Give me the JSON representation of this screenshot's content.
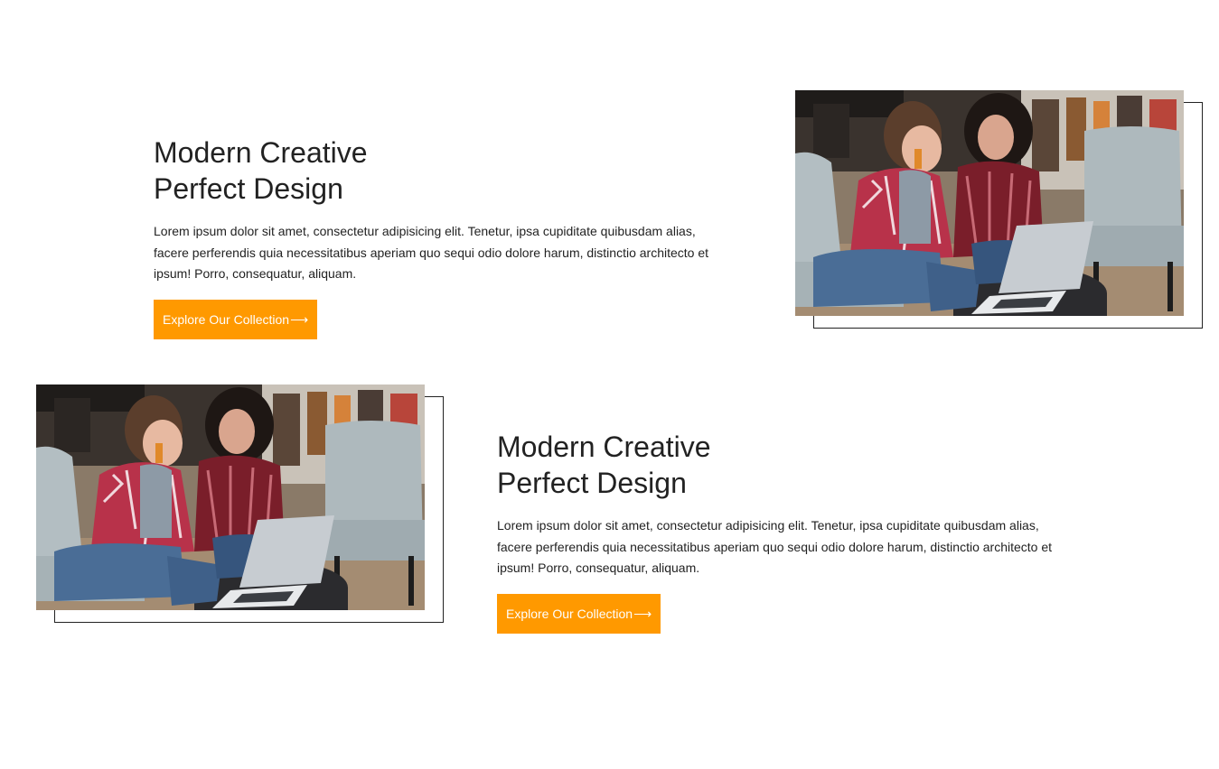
{
  "sections": [
    {
      "headline_line1": "Modern Creative",
      "headline_line2": "Perfect Design",
      "body": "Lorem ipsum dolor sit amet, consectetur adipisicing elit. Tenetur, ipsa cupiditate quibusdam alias, facere perferendis quia necessitatibus aperiam quo sequi odio dolore harum, distinctio architecto et ipsum! Porro, consequatur, aliquam.",
      "cta_label": "Explore Our Collection",
      "cta_arrow": "⟶"
    },
    {
      "headline_line1": "Modern Creative",
      "headline_line2": "Perfect Design",
      "body": "Lorem ipsum dolor sit amet, consectetur adipisicing elit. Tenetur, ipsa cupiditate quibusdam alias, facere perferendis quia necessitatibus aperiam quo sequi odio dolore harum, distinctio architecto et ipsum! Porro, consequatur, aliquam.",
      "cta_label": "Explore Our Collection",
      "cta_arrow": "⟶"
    }
  ],
  "colors": {
    "accent": "#ff9900",
    "text": "#222222",
    "background": "#ffffff"
  },
  "images": [
    {
      "name": "two-women-laptop-library-photo"
    },
    {
      "name": "two-women-laptop-library-photo"
    }
  ]
}
